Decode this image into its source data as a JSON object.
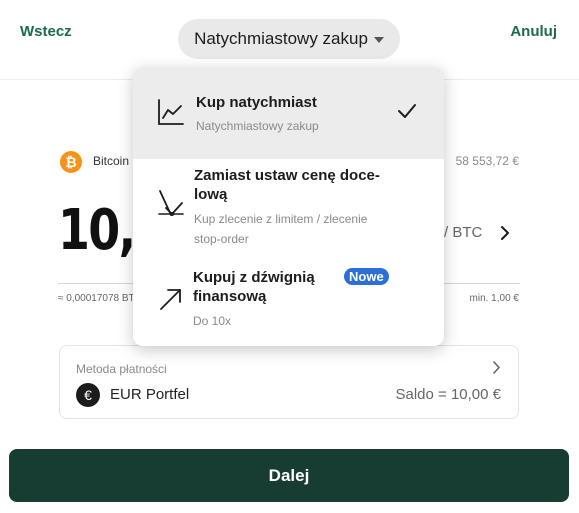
{
  "header": {
    "back_label": "Wstecz",
    "mode_label": "Natychmiastowy zakup",
    "cancel_label": "Anuluj"
  },
  "asset": {
    "name": "Bitcoin",
    "price": "58 553,72 €",
    "icon": "bitcoin-icon"
  },
  "amount": {
    "value": "10,00 €",
    "currency_toggle": "/ BTC",
    "btc_equivalent": "≈ 0,00017078 BTC",
    "minimum": "min. 1,00 €"
  },
  "payment": {
    "label": "Metoda płatności",
    "wallet": "EUR Portfel",
    "balance": "Saldo = 10,00 €",
    "icon": "euro-icon"
  },
  "continue_label": "Dalej",
  "dropdown": {
    "items": [
      {
        "title": "Kup natychmiast",
        "subtitle": "Natychmiastowy zakup",
        "icon": "line-chart-icon",
        "selected": true
      },
      {
        "title": "Zamiast ustaw cenę doce-\nlową",
        "subtitle": "Kup zlecenie z limitem / zlecenie\nstop-order",
        "icon": "target-price-icon",
        "selected": false
      },
      {
        "title": "Kupuj z dźwignią\nfinansową",
        "subtitle": "Do 10x",
        "badge": "Nowe",
        "icon": "leverage-arrow-icon",
        "selected": false
      }
    ]
  },
  "colors": {
    "accent_green": "#1d6b4a",
    "button_dark_green": "#173d33",
    "bitcoin_orange": "#f7931a",
    "badge_blue": "#2c6fd6"
  }
}
